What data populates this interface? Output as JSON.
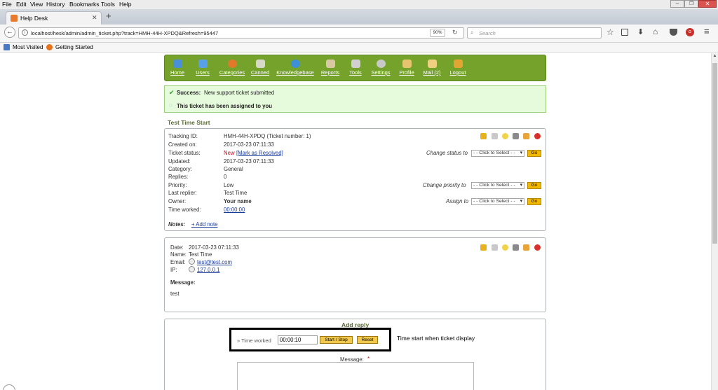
{
  "browser": {
    "menu": [
      "File",
      "Edit",
      "View",
      "History",
      "Bookmarks",
      "Tools",
      "Help"
    ],
    "tab_title": "Help Desk",
    "tab_new": "+",
    "url": "localhost/hesk/admin/admin_ticket.php?track=HMH-44H-XPDQ&Refresh=95447",
    "zoom": "90%",
    "search_placeholder": "Search",
    "bookmarks": [
      "Most Visited",
      "Getting Started"
    ]
  },
  "nav": [
    {
      "label": "Home",
      "color": "#4a90d9"
    },
    {
      "label": "Users",
      "color": "#5aa0e8"
    },
    {
      "label": "Categories",
      "color": "#e07a2a"
    },
    {
      "label": "Canned",
      "color": "#d8d8c8"
    },
    {
      "label": "Knowledgebase",
      "color": "#3d8fd6"
    },
    {
      "label": "Reports",
      "color": "#d9c9a3"
    },
    {
      "label": "Tools",
      "color": "#d0d0d0"
    },
    {
      "label": "Settings",
      "color": "#c8c8c8"
    },
    {
      "label": "Profile",
      "color": "#e5c470"
    },
    {
      "label": "Mail (2)",
      "color": "#efd080"
    },
    {
      "label": "Logout",
      "color": "#e3a531"
    }
  ],
  "alert": {
    "success_strong": "Success:",
    "success_text": "New support ticket submitted",
    "assigned_text": "This ticket has been assigned to you"
  },
  "ticket": {
    "subject": "Test Time Start",
    "tracking_id_label": "Tracking ID:",
    "tracking_id": "HMH-44H-XPDQ (Ticket number: 1)",
    "created_label": "Created on:",
    "created": "2017-03-23 07:11:33",
    "status_label": "Ticket status:",
    "status": "New",
    "resolve_link": "[Mark as Resolved]",
    "updated_label": "Updated:",
    "updated": "2017-03-23 07:11:33",
    "category_label": "Category:",
    "category": "General",
    "replies_label": "Replies:",
    "replies": "0",
    "priority_label": "Priority:",
    "priority": "Low",
    "last_replier_label": "Last replier:",
    "last_replier": "Test Time",
    "owner_label": "Owner:",
    "owner": "Your name",
    "time_worked_label": "Time worked:",
    "time_worked": "00:00:00",
    "notes_label": "Notes:",
    "add_note": "+ Add note",
    "change_status_label": "Change status to",
    "change_priority_label": "Change priority to",
    "assign_label": "Assign to",
    "select_placeholder": "- - Click to Select - -",
    "go": "Go"
  },
  "message": {
    "date_label": "Date:",
    "date": "2017-03-23 07:11:33",
    "name_label": "Name:",
    "name": "Test Time",
    "email_label": "Email:",
    "email": "test@test.com",
    "ip_label": "IP:",
    "ip": "127.0.0.1",
    "message_label": "Message:",
    "body": "test"
  },
  "reply": {
    "title": "Add reply",
    "time_worked_label": "» Time worked",
    "time_value": "00:00:10",
    "start_stop": "Start / Stop",
    "reset": "Reset",
    "annotation": "Time start when ticket display",
    "message_label": "Message:",
    "required": "*"
  }
}
